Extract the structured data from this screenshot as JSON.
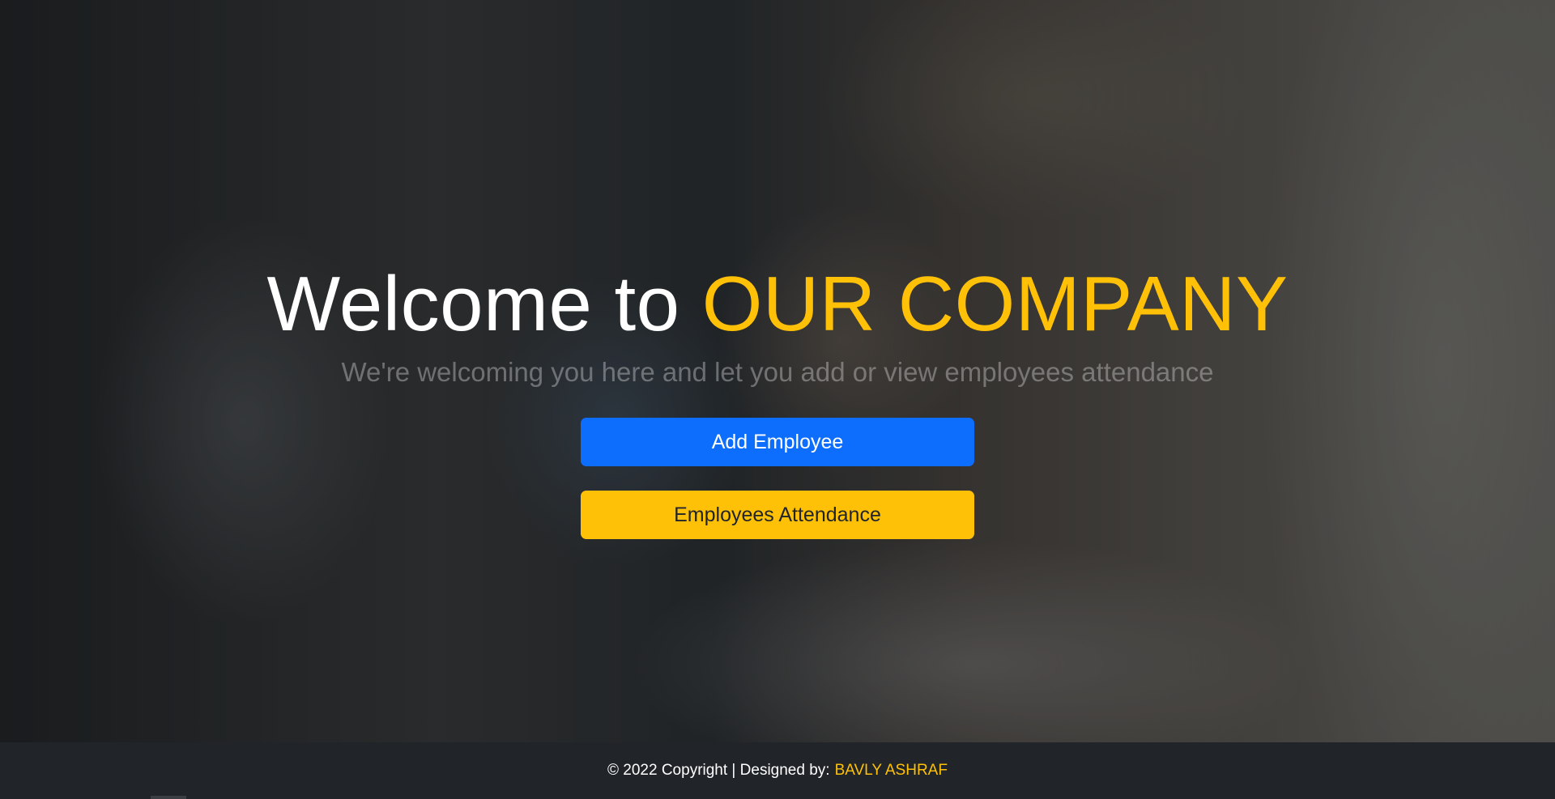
{
  "hero": {
    "title_prefix": "Welcome to",
    "title_accent": "OUR COMPANY",
    "subtitle": "We're welcoming you here and let you add or view employees attendance"
  },
  "actions": {
    "add_employee_label": "Add Employee",
    "attendance_label": "Employees Attendance"
  },
  "footer": {
    "copyright_text": "© 2022 Copyright | Designed by:",
    "author": "BAVLY ASHRAF"
  },
  "colors": {
    "accent": "#ffc107",
    "primary": "#0d6efd",
    "footer_bg": "#212529"
  }
}
